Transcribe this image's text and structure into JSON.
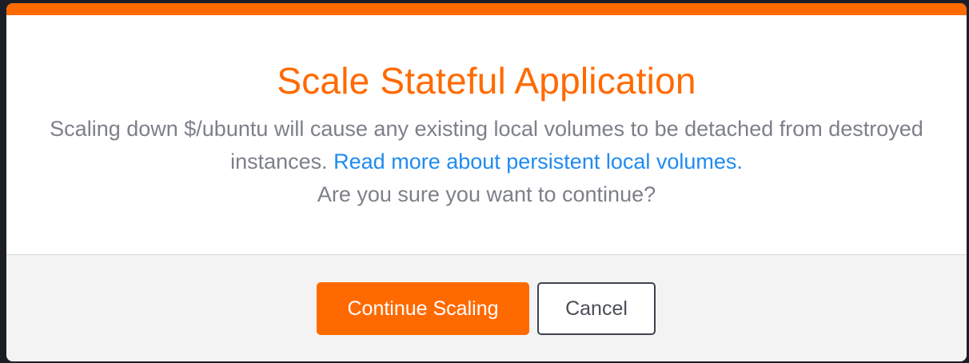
{
  "modal": {
    "title": "Scale Stateful Application",
    "message_line1": "Scaling down $/ubuntu will cause any existing local volumes to be detached from destroyed instances. ",
    "link_text": "Read more about persistent local volumes.",
    "message_line2": "Are you sure you want to continue?",
    "confirm_label": "Continue Scaling",
    "cancel_label": "Cancel"
  },
  "colors": {
    "accent": "#ff6a00",
    "link": "#1f8bf0",
    "body_text": "#7d8088",
    "footer_bg": "#f3f3f4"
  }
}
